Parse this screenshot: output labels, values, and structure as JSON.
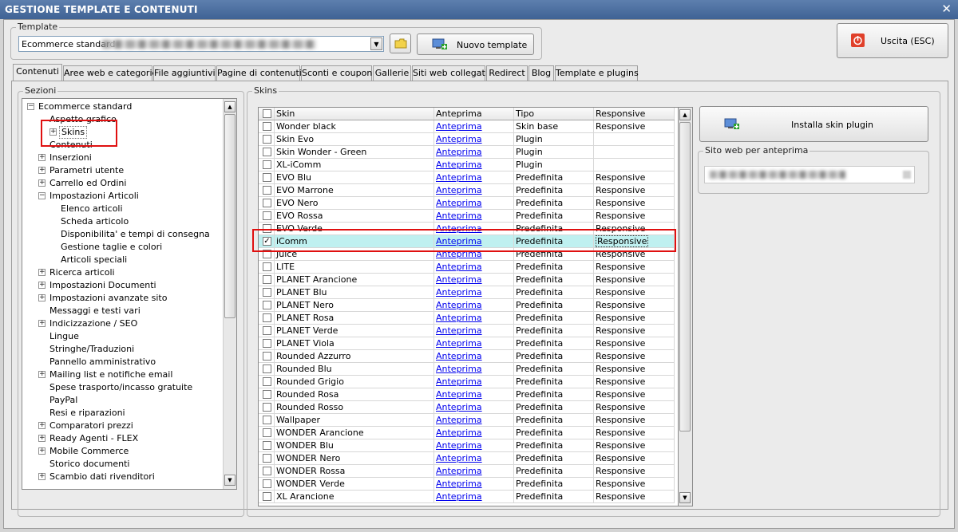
{
  "window": {
    "title": "GESTIONE TEMPLATE E CONTENUTI",
    "close_glyph": "✕"
  },
  "template_group": {
    "title": "Template",
    "selected": "Ecommerce standard",
    "new_button": "Nuovo template"
  },
  "exit_button": "Uscita (ESC)",
  "tabs": [
    "Contenuti",
    "Aree web e categorie",
    "File aggiuntivi",
    "Pagine di contenuti",
    "Sconti e coupon",
    "Gallerie",
    "Siti web collegati",
    "Redirect",
    "Blog",
    "Template e plugins"
  ],
  "sections": {
    "title": "Sezioni",
    "tree": [
      {
        "label": "Ecommerce standard",
        "level": 0,
        "expander": "−"
      },
      {
        "label": "Aspetto grafico",
        "level": 1,
        "expander": ""
      },
      {
        "label": "Skins",
        "level": 2,
        "expander": "+"
      },
      {
        "label": "Contenuti",
        "level": 1,
        "expander": ""
      },
      {
        "label": "Inserzioni",
        "level": 1,
        "expander": "+"
      },
      {
        "label": "Parametri utente",
        "level": 1,
        "expander": "+"
      },
      {
        "label": "Carrello ed Ordini",
        "level": 1,
        "expander": "+"
      },
      {
        "label": "Impostazioni Articoli",
        "level": 1,
        "expander": "−"
      },
      {
        "label": "Elenco articoli",
        "level": 2,
        "expander": ""
      },
      {
        "label": "Scheda articolo",
        "level": 2,
        "expander": ""
      },
      {
        "label": "Disponibilita' e tempi di consegna",
        "level": 2,
        "expander": ""
      },
      {
        "label": "Gestione taglie e colori",
        "level": 2,
        "expander": ""
      },
      {
        "label": "Articoli speciali",
        "level": 2,
        "expander": ""
      },
      {
        "label": "Ricerca articoli",
        "level": 1,
        "expander": "+"
      },
      {
        "label": "Impostazioni Documenti",
        "level": 1,
        "expander": "+"
      },
      {
        "label": "Impostazioni avanzate sito",
        "level": 1,
        "expander": "+"
      },
      {
        "label": "Messaggi e testi vari",
        "level": 1,
        "expander": ""
      },
      {
        "label": "Indicizzazione / SEO",
        "level": 1,
        "expander": "+"
      },
      {
        "label": "Lingue",
        "level": 1,
        "expander": ""
      },
      {
        "label": "Stringhe/Traduzioni",
        "level": 1,
        "expander": ""
      },
      {
        "label": "Pannello amministrativo",
        "level": 1,
        "expander": ""
      },
      {
        "label": "Mailing list e notifiche email",
        "level": 1,
        "expander": "+"
      },
      {
        "label": "Spese trasporto/incasso gratuite",
        "level": 1,
        "expander": ""
      },
      {
        "label": "PayPal",
        "level": 1,
        "expander": ""
      },
      {
        "label": "Resi e riparazioni",
        "level": 1,
        "expander": ""
      },
      {
        "label": "Comparatori prezzi",
        "level": 1,
        "expander": "+"
      },
      {
        "label": "Ready Agenti - FLEX",
        "level": 1,
        "expander": "+"
      },
      {
        "label": "Mobile Commerce",
        "level": 1,
        "expander": "+"
      },
      {
        "label": "Storico documenti",
        "level": 1,
        "expander": ""
      },
      {
        "label": "Scambio dati rivenditori",
        "level": 1,
        "expander": "+"
      }
    ]
  },
  "skins": {
    "title": "Skins",
    "columns": [
      "Skin",
      "Anteprima",
      "Tipo",
      "Responsive"
    ],
    "rows": [
      {
        "skin": "Wonder black",
        "preview": "Anteprima",
        "type": "Skin base",
        "responsive": "Responsive",
        "checked": false
      },
      {
        "skin": "Skin Evo",
        "preview": "Anteprima",
        "type": "Plugin",
        "responsive": "",
        "checked": false
      },
      {
        "skin": "Skin Wonder - Green",
        "preview": "Anteprima",
        "type": "Plugin",
        "responsive": "",
        "checked": false
      },
      {
        "skin": "XL-iComm",
        "preview": "Anteprima",
        "type": "Plugin",
        "responsive": "",
        "checked": false
      },
      {
        "skin": "EVO Blu",
        "preview": "Anteprima",
        "type": "Predefinita",
        "responsive": "Responsive",
        "checked": false
      },
      {
        "skin": "EVO Marrone",
        "preview": "Anteprima",
        "type": "Predefinita",
        "responsive": "Responsive",
        "checked": false
      },
      {
        "skin": "EVO Nero",
        "preview": "Anteprima",
        "type": "Predefinita",
        "responsive": "Responsive",
        "checked": false
      },
      {
        "skin": "EVO Rossa",
        "preview": "Anteprima",
        "type": "Predefinita",
        "responsive": "Responsive",
        "checked": false
      },
      {
        "skin": "EVO Verde",
        "preview": "Anteprima",
        "type": "Predefinita",
        "responsive": "Responsive",
        "checked": false
      },
      {
        "skin": "iComm",
        "preview": "Anteprima",
        "type": "Predefinita",
        "responsive": "Responsive",
        "checked": true,
        "selected": true
      },
      {
        "skin": "Juice",
        "preview": "Anteprima",
        "type": "Predefinita",
        "responsive": "Responsive",
        "checked": false
      },
      {
        "skin": "LITE",
        "preview": "Anteprima",
        "type": "Predefinita",
        "responsive": "Responsive",
        "checked": false
      },
      {
        "skin": "PLANET Arancione",
        "preview": "Anteprima",
        "type": "Predefinita",
        "responsive": "Responsive",
        "checked": false
      },
      {
        "skin": "PLANET Blu",
        "preview": "Anteprima",
        "type": "Predefinita",
        "responsive": "Responsive",
        "checked": false
      },
      {
        "skin": "PLANET Nero",
        "preview": "Anteprima",
        "type": "Predefinita",
        "responsive": "Responsive",
        "checked": false
      },
      {
        "skin": "PLANET Rosa",
        "preview": "Anteprima",
        "type": "Predefinita",
        "responsive": "Responsive",
        "checked": false
      },
      {
        "skin": "PLANET Verde",
        "preview": "Anteprima",
        "type": "Predefinita",
        "responsive": "Responsive",
        "checked": false
      },
      {
        "skin": "PLANET Viola",
        "preview": "Anteprima",
        "type": "Predefinita",
        "responsive": "Responsive",
        "checked": false
      },
      {
        "skin": "Rounded Azzurro",
        "preview": "Anteprima",
        "type": "Predefinita",
        "responsive": "Responsive",
        "checked": false
      },
      {
        "skin": "Rounded Blu",
        "preview": "Anteprima",
        "type": "Predefinita",
        "responsive": "Responsive",
        "checked": false
      },
      {
        "skin": "Rounded Grigio",
        "preview": "Anteprima",
        "type": "Predefinita",
        "responsive": "Responsive",
        "checked": false
      },
      {
        "skin": "Rounded Rosa",
        "preview": "Anteprima",
        "type": "Predefinita",
        "responsive": "Responsive",
        "checked": false
      },
      {
        "skin": "Rounded Rosso",
        "preview": "Anteprima",
        "type": "Predefinita",
        "responsive": "Responsive",
        "checked": false
      },
      {
        "skin": "Wallpaper",
        "preview": "Anteprima",
        "type": "Predefinita",
        "responsive": "Responsive",
        "checked": false
      },
      {
        "skin": "WONDER Arancione",
        "preview": "Anteprima",
        "type": "Predefinita",
        "responsive": "Responsive",
        "checked": false
      },
      {
        "skin": "WONDER Blu",
        "preview": "Anteprima",
        "type": "Predefinita",
        "responsive": "Responsive",
        "checked": false
      },
      {
        "skin": "WONDER Nero",
        "preview": "Anteprima",
        "type": "Predefinita",
        "responsive": "Responsive",
        "checked": false
      },
      {
        "skin": "WONDER Rossa",
        "preview": "Anteprima",
        "type": "Predefinita",
        "responsive": "Responsive",
        "checked": false
      },
      {
        "skin": "WONDER Verde",
        "preview": "Anteprima",
        "type": "Predefinita",
        "responsive": "Responsive",
        "checked": false
      },
      {
        "skin": "XL Arancione",
        "preview": "Anteprima",
        "type": "Predefinita",
        "responsive": "Responsive",
        "checked": false
      }
    ]
  },
  "install_button": "Installa skin plugin",
  "preview_site": {
    "title": "Sito web per anteprima"
  },
  "icons": {
    "exit": "power-icon",
    "folder": "folder-icon",
    "new_template": "monitor-add-icon",
    "install": "monitor-add-icon"
  },
  "colors": {
    "highlight": "#e01010",
    "selected_row": "#bff0f0",
    "titlebar": "#4a6c9e"
  }
}
